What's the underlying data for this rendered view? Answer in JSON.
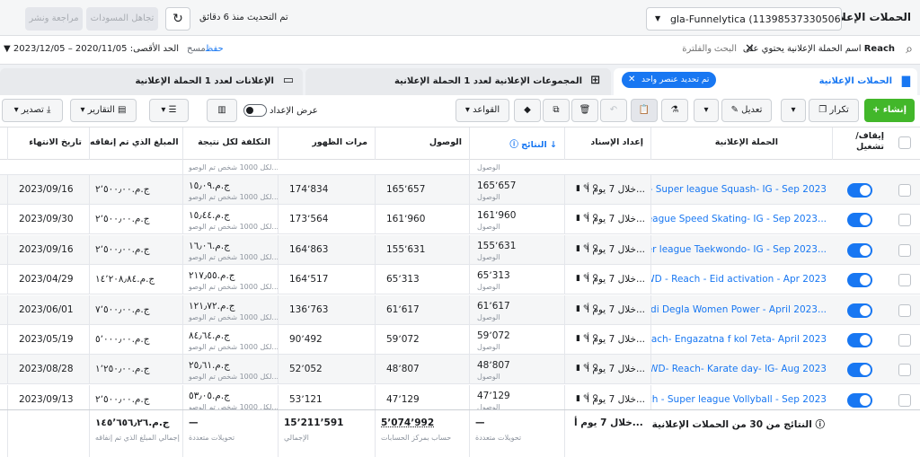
{
  "header": {
    "title": "الحملات الإعلانية",
    "account": "gla-Funnelytica (1139853733050606)...",
    "updated": "تم التحديث منذ 6 دقائق",
    "discard_label": "تجاهل المسودات",
    "review_label": "مراجعة ونشر"
  },
  "search": {
    "filter_prefix": "اسم الحملة الإعلانية يحتوي على",
    "filter_value": "Reach",
    "placeholder": "البحث والفلترة",
    "save_label": "حفظ",
    "clear_label": "مسح",
    "date_range": "الحد الأقصى: 2020/11/05 – 2023/12/05"
  },
  "tabs": {
    "campaigns": "الحملات الإعلانية",
    "adsets": "المجموعات الإعلانية لعدد 1 الحملة الإعلانية",
    "ads": "الإعلانات لعدد 1 الحملة الإعلانية",
    "selected_badge": "تم تحديد عنصر واحد"
  },
  "toolbar": {
    "create": "+ إنشاء",
    "duplicate": "تكرار",
    "edit": "تعديل",
    "rules": "القواعد",
    "setup_view": "عرض الإعداد",
    "reports": "التقارير",
    "export": "تصدير"
  },
  "columns": {
    "toggle": "إيقاف/تشغيل",
    "name": "الحملة الإعلانية",
    "attribution": "إعداد الإسناد",
    "results": "النتائج",
    "reach": "الوصول",
    "impressions": "مرات الظهور",
    "cost": "التكلفة لكل نتيجة",
    "spent": "المبلغ الذي تم إنفاقه",
    "end": "تاريخ الانتهاء"
  },
  "partial_row": {
    "results_sub": "الوصول",
    "cost_sub": "لكل 1000 شخص تم الوصو..."
  },
  "rows": [
    {
      "name": "... Reach - Super league Squash- IG - Sep 2023",
      "attribution": "خلال 7 يوم أ...",
      "results": "165٬657",
      "results_sub": "الوصول",
      "reach": "165٬657",
      "impressions": "174٬834",
      "cost": "ج.م.‏١٥٫٠٩",
      "cost_sub": "لكل 1000 شخص تم الوصو...",
      "spent": "ج.م.‏٢٬٥٠٠٫٠٠",
      "end": "2023/09/16"
    },
    {
      "name": "ch - Super league Speed Skating- IG - Sep 2023...",
      "attribution": "خلال 7 يوم أ...",
      "results": "161٬960",
      "results_sub": "الوصول",
      "reach": "161٬960",
      "impressions": "173٬564",
      "cost": "ج.م.‏١٥٫٤٤",
      "cost_sub": "لكل 1000 شخص تم الوصو...",
      "spent": "ج.م.‏٢٬٥٠٠٫٠٠",
      "end": "2023/09/30"
    },
    {
      "name": "each - Super league Taekwondo- IG - Sep 2023...",
      "attribution": "خلال 7 يوم أ...",
      "results": "155٬631",
      "results_sub": "الوصول",
      "reach": "155٬631",
      "impressions": "164٬863",
      "cost": "ج.م.‏١٦٫٠٦",
      "cost_sub": "لكل 1000 شخص تم الوصو...",
      "spent": "ج.م.‏٢٬٥٠٠٫٠٠",
      "end": "2023/09/16"
    },
    {
      "name": "WD - Reach - Eid activation - Apr 2023",
      "attribution": "خلال 7 يوم أ...",
      "results": "65٬313",
      "results_sub": "الوصول",
      "reach": "65٬313",
      "impressions": "164٬517",
      "cost": "ج.م.‏٢١٧٫٥٥",
      "cost_sub": "لكل 1000 شخص تم الوصو...",
      "spent": "ج.م.‏١٤٬٢٠٨٫٨٤",
      "end": "2023/04/29"
    },
    {
      "name": "Reach- Wadi Degla Women Power - April 2023...",
      "attribution": "خلال 7 يوم أ...",
      "results": "61٬617",
      "results_sub": "الوصول",
      "reach": "61٬617",
      "impressions": "136٬763",
      "cost": "ج.م.‏١٢١٫٧٢",
      "cost_sub": "لكل 1000 شخص تم الوصو...",
      "spent": "ج.م.‏٧٬٥٠٠٫٠٠",
      "end": "2023/06/01"
    },
    {
      "name": "WD- Reach- Engazatna f kol 7eta- April 2023",
      "attribution": "خلال 7 يوم أ...",
      "results": "59٬072",
      "results_sub": "الوصول",
      "reach": "59٬072",
      "impressions": "90٬492",
      "cost": "ج.م.‏٨٤٫٦٤",
      "cost_sub": "لكل 1000 شخص تم الوصو...",
      "spent": "ج.م.‏٥٬٠٠٠٫٠٠",
      "end": "2023/05/19"
    },
    {
      "name": "WD- Reach- Karate day- IG- Aug 2023",
      "attribution": "خلال 7 يوم أ...",
      "results": "48٬807",
      "results_sub": "الوصول",
      "reach": "48٬807",
      "impressions": "52٬052",
      "cost": "ج.م.‏٢٥٫٦١",
      "cost_sub": "لكل 1000 شخص تم الوصو...",
      "spent": "ج.م.‏١٬٢٥٠٫٠٠",
      "end": "2023/08/28"
    },
    {
      "name": "WD- Reach - Super league Vollyball - Sep 2023",
      "attribution": "خلال 7 يوم أ...",
      "results": "47٬129",
      "results_sub": "الوصول",
      "reach": "47٬129",
      "impressions": "53٬121",
      "cost": "ج.م.‏٥٣٫٠٥",
      "cost_sub": "لكل 1000 شخص تم الوصو...",
      "spent": "ج.م.‏٢٬٥٠٠٫٠٠",
      "end": "2023/09/13"
    }
  ],
  "footer": {
    "label": "النتائج من 30 من الحملات الإعلانية",
    "attribution": "خلال 7 يوم أ...",
    "results": "—",
    "results_sub": "تحويلات متعددة",
    "reach": "5٬074٬992",
    "reach_sub": "حساب بمركز الحسابات",
    "impressions": "15٬211٬591",
    "impressions_sub": "الإجمالي",
    "cost": "—",
    "cost_sub": "تحويلات متعددة",
    "spent": "ج.م.‏١٤٥٬٦٥٦٫٢٦",
    "spent_sub": "إجمالي المبلغ الذي تم إنفاقه"
  }
}
